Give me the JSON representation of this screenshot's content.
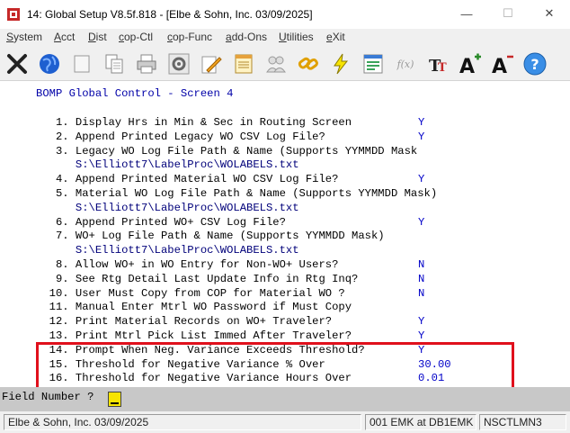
{
  "window": {
    "title": "14: Global Setup V8.5f.818 - [Elbe & Sohn, Inc. 03/09/2025]",
    "minimize_glyph": "—",
    "maximize_glyph": "☐",
    "close_glyph": "✕"
  },
  "menu": [
    {
      "label": "System",
      "u": "S",
      "rest": "ystem"
    },
    {
      "label": "Acct",
      "u": "A",
      "rest": "cct"
    },
    {
      "label": "Dist",
      "u": "D",
      "rest": "ist"
    },
    {
      "label": "cop-Ctl",
      "u": "c",
      "rest": "op-Ctl"
    },
    {
      "label": "cop-Func",
      "u": "c",
      "rest": "op-Func"
    },
    {
      "label": "add-Ons",
      "u": "a",
      "rest": "dd-Ons"
    },
    {
      "label": "Utilities",
      "u": "U",
      "rest": "tilities"
    },
    {
      "label": "eXit",
      "u": "e",
      "rest": "Xit"
    }
  ],
  "toolbar": {
    "icons": [
      "close-x-icon",
      "globe-icon",
      "blank-icon",
      "copy-icon",
      "print-icon",
      "settings-gear-icon",
      "edit-pencil-icon",
      "notepad-icon",
      "users-icon",
      "chain-link-icon",
      "lightning-icon",
      "form-icon",
      "function-icon",
      "font-icon",
      "increase-font-icon",
      "decrease-font-icon",
      "help-icon"
    ],
    "font_glyph": "TT",
    "increase_glyph": "A+",
    "decrease_glyph": "A-",
    "help_glyph": "?",
    "function_glyph": "f(x)"
  },
  "screen": {
    "heading": "BOMP Global Control - Screen 4",
    "lines": [
      {
        "text": "   1. Display Hrs in Min & Sec in Routing Screen",
        "value": "Y"
      },
      {
        "text": "   2. Append Printed Legacy WO CSV Log File?",
        "value": "Y"
      },
      {
        "text": "   3. Legacy WO Log File Path & Name (Supports YYMMDD Mask",
        "value": ""
      },
      {
        "text": "      S:\\Elliott7\\LabelProc\\WOLABELS.txt",
        "value": "",
        "path": true
      },
      {
        "text": "   4. Append Printed Material WO CSV Log File?",
        "value": "Y"
      },
      {
        "text": "   5. Material WO Log File Path & Name (Supports YYMMDD Mask)",
        "value": ""
      },
      {
        "text": "      S:\\Elliott7\\LabelProc\\WOLABELS.txt",
        "value": "",
        "path": true
      },
      {
        "text": "   6. Append Printed WO+ CSV Log File?",
        "value": "Y"
      },
      {
        "text": "   7. WO+ Log File Path & Name (Supports YYMMDD Mask)",
        "value": ""
      },
      {
        "text": "      S:\\Elliott7\\LabelProc\\WOLABELS.txt",
        "value": "",
        "path": true
      },
      {
        "text": "   8. Allow WO+ in WO Entry for Non-WO+ Users?",
        "value": "N"
      },
      {
        "text": "   9. See Rtg Detail Last Update Info in Rtg Inq?",
        "value": "N"
      },
      {
        "text": "  10. User Must Copy from COP for Material WO ?",
        "value": "N"
      },
      {
        "text": "  11. Manual Enter Mtrl WO Password if Must Copy",
        "value": ""
      },
      {
        "text": "  12. Print Material Records on WO+ Traveler?",
        "value": "Y"
      },
      {
        "text": "  13. Print Mtrl Pick List Immed After Traveler?",
        "value": "Y"
      },
      {
        "text": "  14. Prompt When Neg. Variance Exceeds Threshold?",
        "value": "Y"
      },
      {
        "text": "  15. Threshold for Negative Variance % Over",
        "value": "30.00"
      },
      {
        "text": "  16. Threshold for Negative Variance Hours Over",
        "value": "0.01"
      }
    ]
  },
  "field_prompt": "Field Number ?",
  "status": {
    "company": "Elbe & Sohn, Inc. 03/09/2025",
    "session": "001 EMK at DB1EMK",
    "terminal": "NSCTLMN3"
  }
}
